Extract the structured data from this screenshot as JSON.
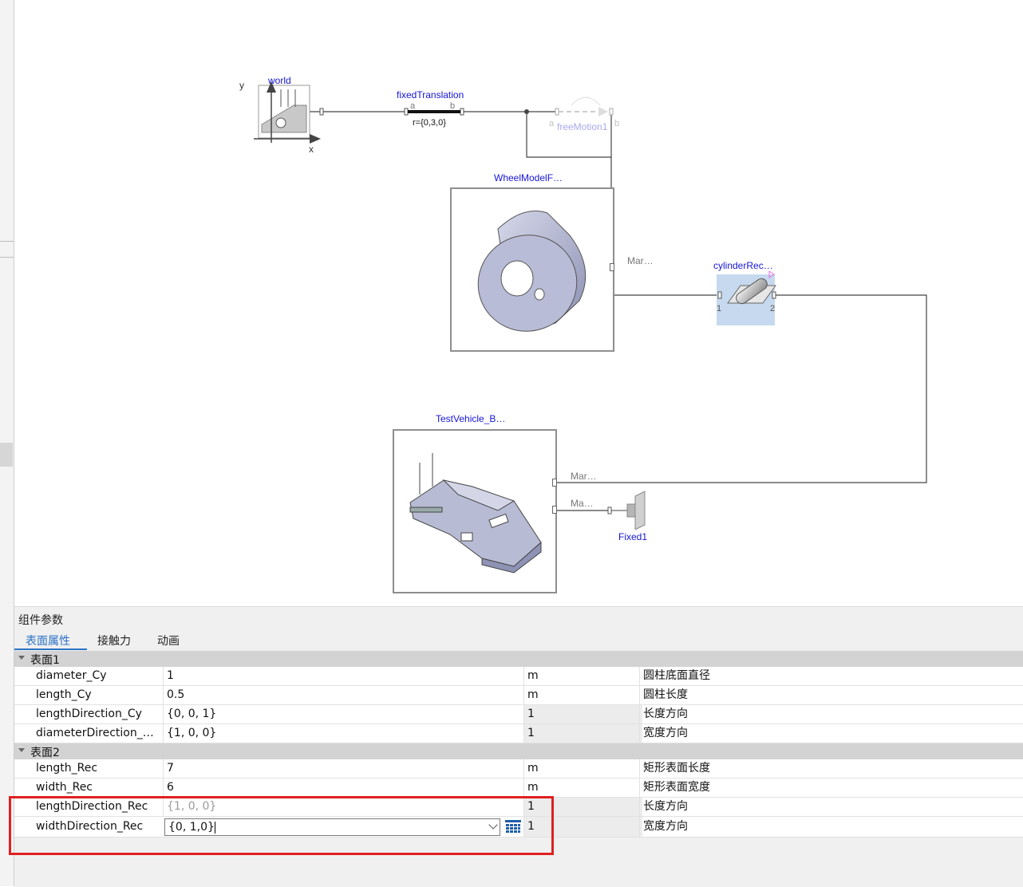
{
  "diagram": {
    "world": {
      "label": "world",
      "axis_y": "y",
      "axis_x": "x"
    },
    "fixed_translation": {
      "label": "fixedTranslation",
      "port_a": "a",
      "port_b": "b",
      "param": "r={0,3,0}"
    },
    "free_motion": {
      "label": "freeMotion1",
      "port_a": "a",
      "port_b": "b"
    },
    "wheel_model": {
      "label": "WheelModelF…",
      "port": "Mar…"
    },
    "cylinder_rec": {
      "label": "cylinderRec…",
      "port_1": "1",
      "port_2": "2"
    },
    "test_vehicle": {
      "label": "TestVehicle_B…",
      "port_1": "Mar…",
      "port_2": "Ma…"
    },
    "fixed": {
      "label": "Fixed1"
    }
  },
  "panel": {
    "title": "组件参数",
    "tabs": [
      {
        "label": "表面属性",
        "active": true
      },
      {
        "label": "接触力",
        "active": false
      },
      {
        "label": "动画",
        "active": false
      }
    ],
    "groups": [
      {
        "label": "表面1",
        "rows": [
          {
            "name": "diameter_Cy",
            "value": "1",
            "unit": "m",
            "desc": "圆柱底面直径"
          },
          {
            "name": "length_Cy",
            "value": "0.5",
            "unit": "m",
            "desc": "圆柱长度"
          },
          {
            "name": "lengthDirection_Cy",
            "value": "{0, 0, 1}",
            "unit": "1",
            "desc": "长度方向"
          },
          {
            "name": "diameterDirection_…",
            "value": "{1, 0, 0}",
            "unit": "1",
            "desc": "宽度方向"
          }
        ]
      },
      {
        "label": "表面2",
        "rows": [
          {
            "name": "length_Rec",
            "value": "7",
            "unit": "m",
            "desc": "矩形表面长度"
          },
          {
            "name": "width_Rec",
            "value": "6",
            "unit": "m",
            "desc": "矩形表面宽度"
          },
          {
            "name": "lengthDirection_Rec",
            "value": "{1, 0, 0}",
            "unit": "1",
            "desc": "长度方向"
          },
          {
            "name": "widthDirection_Rec",
            "value": "{0, 1,0}",
            "unit": "1",
            "desc": "宽度方向"
          }
        ]
      }
    ]
  },
  "colors": {
    "accent": "#2a73c6",
    "highlight_box": "#e02020",
    "label_blue": "#1515d6"
  }
}
